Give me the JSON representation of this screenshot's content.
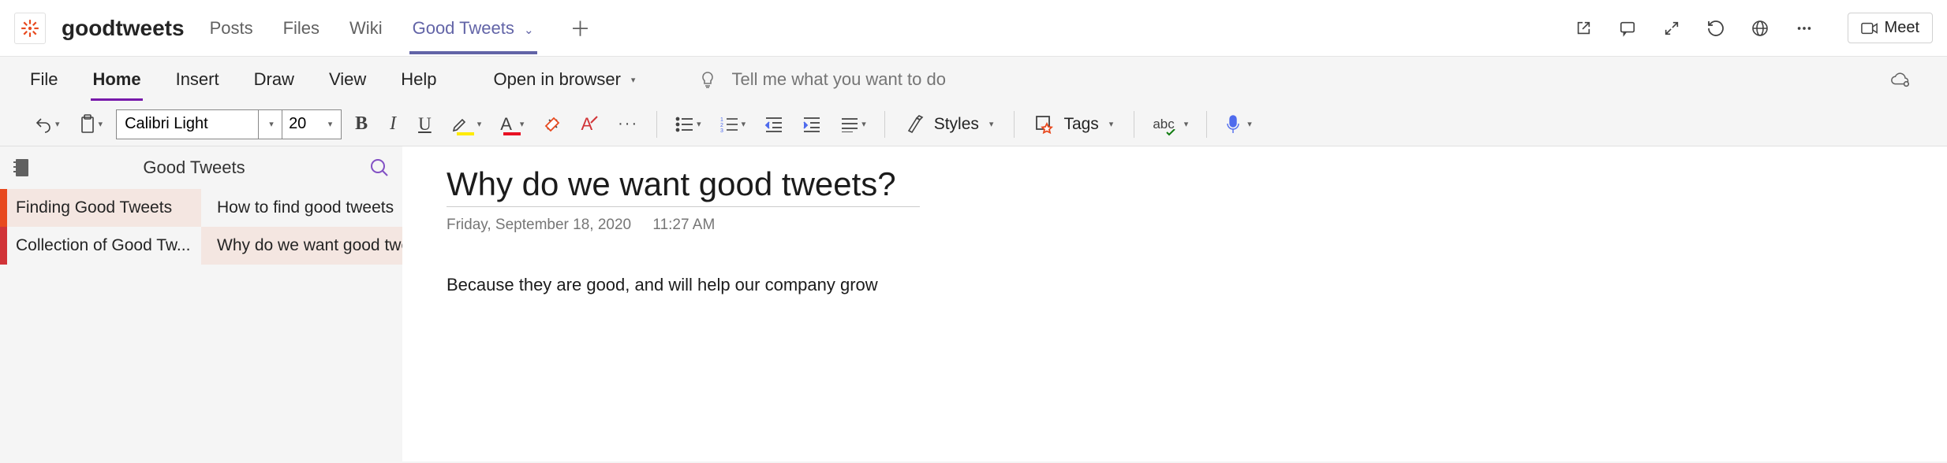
{
  "header": {
    "team_name": "goodtweets",
    "tabs": [
      "Posts",
      "Files",
      "Wiki",
      "Good Tweets"
    ],
    "active_tab_index": 3,
    "meet_label": "Meet"
  },
  "ribbon": {
    "tabs": [
      "File",
      "Home",
      "Insert",
      "Draw",
      "View",
      "Help"
    ],
    "active_tab_index": 1,
    "open_in_browser_label": "Open in browser",
    "tell_me_placeholder": "Tell me what you want to do"
  },
  "toolbar": {
    "font_name": "Calibri Light",
    "font_size": "20",
    "styles_label": "Styles",
    "tags_label": "Tags"
  },
  "nav": {
    "notebook_title": "Good Tweets",
    "sections": [
      "Finding Good Tweets",
      "Collection of Good Tw..."
    ],
    "pages": [
      "How to find good tweets",
      "Why do we want good twe..."
    ],
    "selected_section_index": 0,
    "selected_page_index": 1
  },
  "page": {
    "title": "Why do we want good tweets?",
    "date": "Friday, September 18, 2020",
    "time": "11:27 AM",
    "body": "Because they are good, and will help our company grow"
  }
}
